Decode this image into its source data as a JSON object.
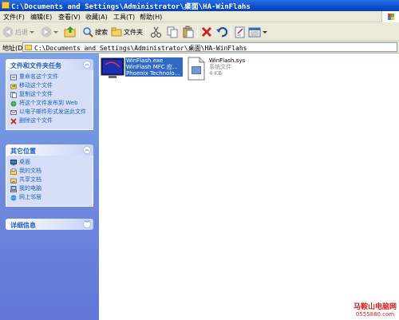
{
  "window": {
    "title": "C:\\Documents and Settings\\Administrator\\桌面\\HA-WinFlahs"
  },
  "menu": [
    {
      "label": "文件(F)"
    },
    {
      "label": "编辑(E)"
    },
    {
      "label": "查看(V)"
    },
    {
      "label": "收藏(A)"
    },
    {
      "label": "工具(T)"
    },
    {
      "label": "帮助(H)"
    }
  ],
  "toolbar": {
    "back": "后退",
    "search": "搜索",
    "folders": "文件夹"
  },
  "address": {
    "label": "地址(D)",
    "value": "C:\\Documents and Settings\\Administrator\\桌面\\HA-WinFlahs"
  },
  "taskpane": {
    "file_tasks": {
      "title": "文件和文件夹任务",
      "items": [
        {
          "label": "重命名这个文件",
          "icon": "rename-icon"
        },
        {
          "label": "移动这个文件",
          "icon": "move-icon"
        },
        {
          "label": "复制这个文件",
          "icon": "copy-icon"
        },
        {
          "label": "将这个文件发布到 Web",
          "icon": "web-publish-icon"
        },
        {
          "label": "以电子邮件形式发送此文件",
          "icon": "email-icon"
        },
        {
          "label": "删除这个文件",
          "icon": "delete-icon"
        }
      ]
    },
    "other_places": {
      "title": "其它位置",
      "items": [
        {
          "label": "桌面",
          "icon": "desktop-icon"
        },
        {
          "label": "我的文档",
          "icon": "documents-icon"
        },
        {
          "label": "共享文档",
          "icon": "shared-docs-icon"
        },
        {
          "label": "我的电脑",
          "icon": "computer-icon"
        },
        {
          "label": "网上邻居",
          "icon": "network-icon"
        }
      ]
    },
    "details": {
      "title": "详细信息"
    }
  },
  "files": [
    {
      "name": "WinFlash.exe",
      "line2": "WinFlash MFC 应...",
      "line3": "Phoenix Technolo...",
      "selected": true,
      "icon": "exe-app-icon"
    },
    {
      "name": "WinFlash.sys",
      "line2": "系统文件",
      "line3": "4 KB",
      "selected": false,
      "icon": "system-file-icon"
    }
  ],
  "watermark": {
    "line1": "马鞍山电脑网",
    "line2": "0555880.com"
  },
  "colors": {
    "titlebar": "#0a4fd0",
    "selection": "#316ac5",
    "taskpane": "#6375d6",
    "link": "#215dc6"
  }
}
